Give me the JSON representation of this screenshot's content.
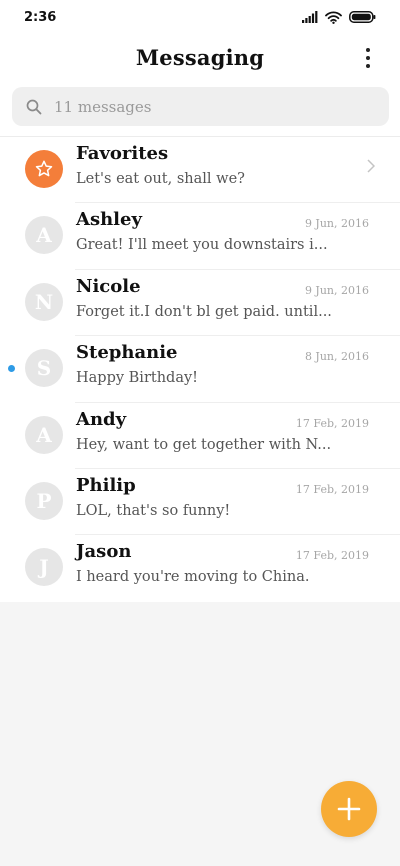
{
  "status_bar": {
    "time": "2:36",
    "icons": [
      "signal-icon",
      "wifi-icon",
      "battery-icon"
    ]
  },
  "header": {
    "title": "Messaging",
    "more_icon": "more-vert-icon"
  },
  "search": {
    "placeholder": "11 messages",
    "icon": "search-icon"
  },
  "favorites": {
    "name": "Favorites",
    "preview": "Let's eat out, shall we?",
    "icon": "star-icon",
    "color": "#f47e3a"
  },
  "conversations": [
    {
      "initial": "A",
      "name": "Ashley",
      "date": "9 Jun, 2016",
      "preview": "Great! I'll meet you downstairs i...",
      "unread": false
    },
    {
      "initial": "N",
      "name": "Nicole",
      "date": "9 Jun, 2016",
      "preview": "Forget it.I don't bl get paid. until...",
      "unread": false
    },
    {
      "initial": "S",
      "name": "Stephanie",
      "date": "8 Jun, 2016",
      "preview": "Happy Birthday!",
      "unread": true
    },
    {
      "initial": "A",
      "name": "Andy",
      "date": "17 Feb, 2019",
      "preview": "Hey, want to get together with N...",
      "unread": false
    },
    {
      "initial": "P",
      "name": "Philip",
      "date": "17 Feb, 2019",
      "preview": "LOL, that's so funny!",
      "unread": false
    },
    {
      "initial": "J",
      "name": "Jason",
      "date": "17 Feb, 2019",
      "preview": "I heard you're moving to China.",
      "unread": false
    }
  ],
  "fab": {
    "icon": "plus-icon",
    "color": "#f7ac36"
  },
  "colors": {
    "unread_dot": "#2e9be6",
    "avatar_bg": "#e6e6e6"
  }
}
